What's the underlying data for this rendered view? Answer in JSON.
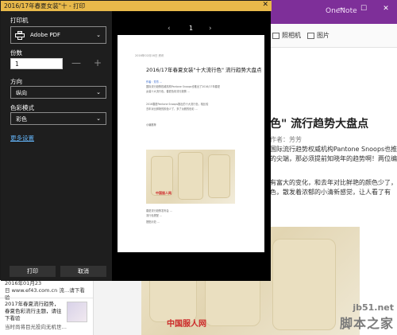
{
  "onenote": {
    "app_name": "OneNote",
    "ribbon": {
      "camera_label": "照相机",
      "image_label": "图片"
    },
    "article_heading": "色\" 流行趋势大盘点",
    "author_line": "作者：芳芳",
    "body_lines": [
      "国际流行趋势权威机构Pantone Snoops也推出了",
      "的尖端，那必须提前知晓年的趋势啊！两位编",
      "有富大的变化，和去年对比鲜艳的颜色少了，",
      "色，散发着浓郁的小清新感觉，让人看了有"
    ],
    "note_list": {
      "top_item": {
        "date": "2016年01月23",
        "snippet": "日 www.ef43.com.cn 流…请下看验",
        "snippet_line2": "当白..."
      },
      "item": {
        "title": "2017年春夏流行趋势，春夏色彩流行主题，请往下看验",
        "date": "",
        "snippet": "当时尚将目光投向无机世…"
      }
    },
    "photo_logo": "中国服人网",
    "watermark_line1": "jb51.net",
    "watermark_line2": "脚本之家"
  },
  "dialog": {
    "title": "2016/17年春夏女装\"十 - 打印",
    "close_glyph": "✕",
    "printer": {
      "label": "打印机",
      "value": "Adobe PDF"
    },
    "copies": {
      "label": "份数",
      "value": "1",
      "minus": "—",
      "plus": "+"
    },
    "orientation": {
      "label": "方向",
      "value": "纵向"
    },
    "color_mode": {
      "label": "色彩模式",
      "value": "彩色"
    },
    "more_settings": "更多设置",
    "print_button": "打印",
    "cancel_button": "取消"
  },
  "preview": {
    "page_number": "1",
    "prev_glyph": "‹",
    "next_glyph": "›",
    "page": {
      "meta": "2016年02月16日     资讯",
      "title": "2016/17年春夏女装\"十大流行色\" 流行趋势大盘点",
      "lines": [
        "作者：芳芳 ...",
        "国际流行趋势权威机构Pantone Snoops也推出了2016/17年春夏",
        "女装十大流行色，春夏色彩流行趋势 ...",
        "",
        "2016春夏Pantone Snoops推出的十大流行色，相比较",
        "去年对比鲜艳的颜色少了，多了淡雅的色彩 ...",
        "",
        "小编推荐"
      ],
      "caption_lines": [
        "春夏流行趋势发布会 ...",
        "流行色搭配 ...",
        "搭配示范 ..."
      ],
      "photo_logo": "中国服人网"
    }
  },
  "colors": {
    "onenote_purple": "#7e2f99",
    "dialog_title_bar": "#e8b94a",
    "settings_panel": "#1e1e1e",
    "link_blue": "#63b2f5"
  },
  "icons": [
    "printer-icon",
    "chevron-down-icon",
    "close-icon",
    "minimize-icon",
    "maximize-icon",
    "camera-icon",
    "image-icon"
  ]
}
